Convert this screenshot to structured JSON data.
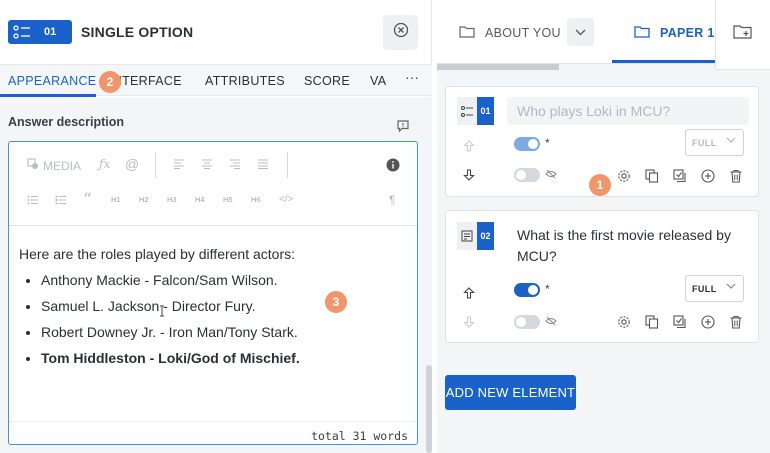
{
  "left_panel": {
    "type_badge_number": "01",
    "title": "SINGLE OPTION",
    "tabs": [
      {
        "label": "APPEARANCE"
      },
      {
        "label": "INTERFACE"
      },
      {
        "label": "ATTRIBUTES"
      },
      {
        "label": "SCORE"
      },
      {
        "label": "VA"
      }
    ],
    "more_label": "···",
    "answer_label": "Answer description",
    "toolbar": {
      "media_label": "MEDIA",
      "headings": [
        "H1",
        "H2",
        "H3",
        "H4",
        "H5",
        "H6"
      ]
    },
    "editor": {
      "intro": "Here are the roles played by different actors:",
      "items": [
        "Anthony Mackie - Falcon/Sam Wilson.",
        "Samuel L. Jackson - Director Fury.",
        "Robert Downey Jr. - Iron Man/Tony Stark.",
        "Tom Hiddleston - Loki/God of Mischief."
      ],
      "word_count": "total 31 words"
    }
  },
  "markers": [
    "1",
    "2",
    "3"
  ],
  "right_panel": {
    "tabs": [
      {
        "label": "ABOUT YOU"
      },
      {
        "label": "PAPER 1"
      }
    ],
    "questions": [
      {
        "number": "01",
        "placeholder": "Who plays Loki in MCU?",
        "required_enabled": true,
        "hidden_enabled": false,
        "required_symbol": "*",
        "width_option": "FULL"
      },
      {
        "number": "02",
        "text": "What is the first movie released by MCU?",
        "required_enabled": true,
        "hidden_enabled": false,
        "required_symbol": "*",
        "width_option": "FULL"
      }
    ],
    "add_button": "ADD NEW ELEMENT"
  },
  "colors": {
    "accent": "#1a62c9",
    "marker": "#f0966a",
    "toggle_on": "#1a62c9",
    "toggle_on_light": "#7da9e6",
    "toggle_off": "#d5d8dd"
  }
}
